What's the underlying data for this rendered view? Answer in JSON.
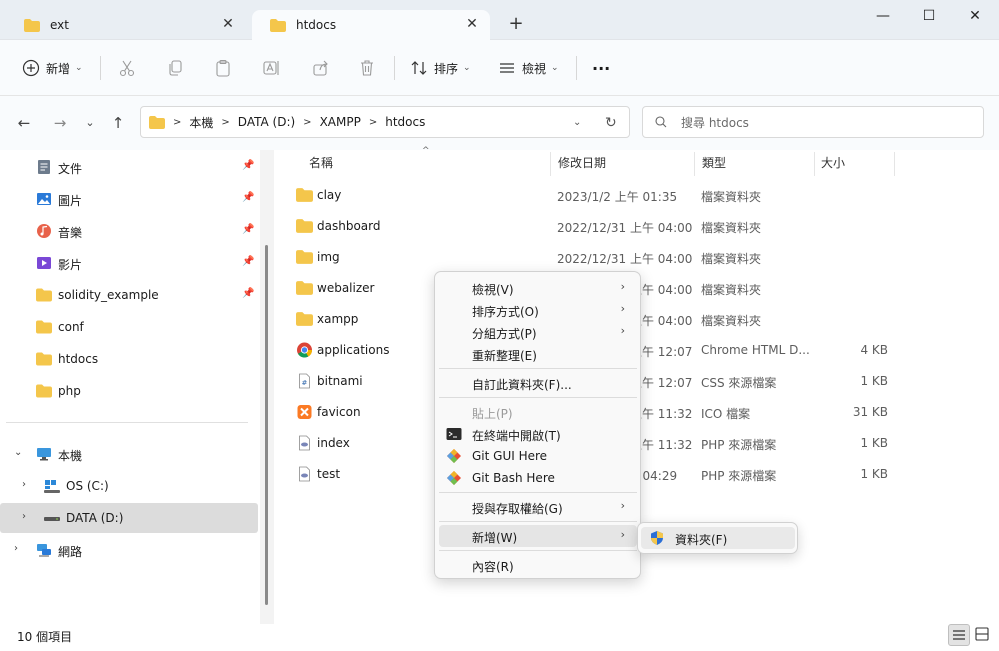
{
  "tabs": [
    {
      "label": "ext",
      "active": false
    },
    {
      "label": "htdocs",
      "active": true
    }
  ],
  "window_controls": {
    "minimize": "—",
    "maximize": "☐",
    "close": "✕"
  },
  "toolbar": {
    "new_label": "新增",
    "sort_label": "排序",
    "view_label": "檢視",
    "more_label": "..."
  },
  "address": {
    "crumbs": [
      "本機",
      "DATA (D:)",
      "XAMPP",
      "htdocs"
    ],
    "search_placeholder": "搜尋 htdocs"
  },
  "sidebar": {
    "quick_access": [
      {
        "label": "文件",
        "icon": "documents-icon",
        "pinned": true
      },
      {
        "label": "圖片",
        "icon": "pictures-icon",
        "pinned": true
      },
      {
        "label": "音樂",
        "icon": "music-icon",
        "pinned": true
      },
      {
        "label": "影片",
        "icon": "videos-icon",
        "pinned": true
      },
      {
        "label": "solidity_example",
        "icon": "folder-icon",
        "pinned": true
      },
      {
        "label": "conf",
        "icon": "folder-icon",
        "pinned": false
      },
      {
        "label": "htdocs",
        "icon": "folder-icon",
        "pinned": false
      },
      {
        "label": "php",
        "icon": "folder-icon",
        "pinned": false
      }
    ],
    "this_pc": "本機",
    "drives": [
      {
        "label": "OS (C:)"
      },
      {
        "label": "DATA (D:)"
      }
    ],
    "network": "網路"
  },
  "columns": {
    "name": "名稱",
    "date": "修改日期",
    "type": "類型",
    "size": "大小"
  },
  "files": [
    {
      "name": "clay",
      "date": "2023/1/2 上午 01:35",
      "type": "檔案資料夾",
      "size": "",
      "icon": "folder-icon"
    },
    {
      "name": "dashboard",
      "date": "2022/12/31 上午 04:00",
      "type": "檔案資料夾",
      "size": "",
      "icon": "folder-icon"
    },
    {
      "name": "img",
      "date": "2022/12/31 上午 04:00",
      "type": "檔案資料夾",
      "size": "",
      "icon": "folder-icon"
    },
    {
      "name": "webalizer",
      "date": "2022/12/31 上午 04:00",
      "type": "檔案資料夾",
      "size": "",
      "icon": "folder-icon"
    },
    {
      "name": "xampp",
      "date": "2022/12/31 上午 04:00",
      "type": "檔案資料夾",
      "size": "",
      "icon": "folder-icon"
    },
    {
      "name": "applications",
      "date": "2022/12/31 上午 12:07",
      "type": "Chrome HTML D...",
      "size": "4 KB",
      "icon": "chrome-icon"
    },
    {
      "name": "bitnami",
      "date": "2022/12/31 上午 12:07",
      "type": "CSS 來源檔案",
      "size": "1 KB",
      "icon": "css-file-icon"
    },
    {
      "name": "favicon",
      "date": "2022/12/31 上午 11:32",
      "type": "ICO 檔案",
      "size": "31 KB",
      "icon": "xampp-icon"
    },
    {
      "name": "index",
      "date": "2022/12/31 上午 11:32",
      "type": "PHP 來源檔案",
      "size": "1 KB",
      "icon": "php-file-icon"
    },
    {
      "name": "test",
      "date": "2023/1/2 上午 04:29",
      "type": "PHP 來源檔案",
      "size": "1 KB",
      "icon": "php-file-icon"
    }
  ],
  "status": {
    "item_count": "10 個項目"
  },
  "context_menu": {
    "view": "檢視(V)",
    "sort_by": "排序方式(O)",
    "group_by": "分組方式(P)",
    "refresh": "重新整理(E)",
    "customize": "自訂此資料夾(F)...",
    "paste": "貼上(P)",
    "open_terminal": "在終端中開啟(T)",
    "git_gui": "Git GUI Here",
    "git_bash": "Git Bash Here",
    "give_access": "授與存取權給(G)",
    "new": "新增(W)",
    "properties": "內容(R)"
  },
  "submenu": {
    "new_folder": "資料夾(F)"
  },
  "colors": {
    "folder": "#f4c64b",
    "accent": "#0067c0"
  }
}
